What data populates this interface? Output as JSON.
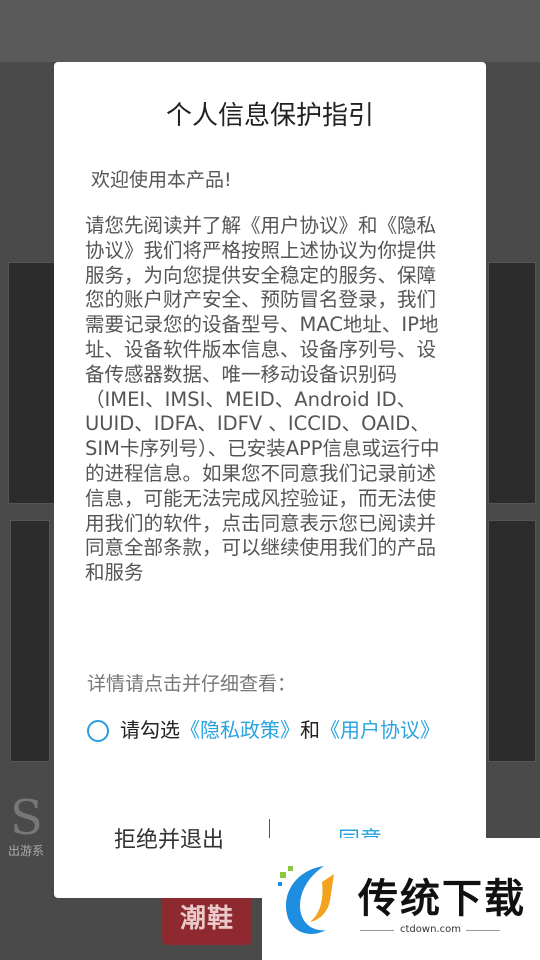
{
  "background": {
    "badge_text": "潮鞋",
    "caption": "出游系"
  },
  "dialog": {
    "title": "个人信息保护指引",
    "welcome": "欢迎使用本产品!",
    "body": "请您先阅读并了解《用户协议》和《隐私协议》我们将严格按照上述协议为你提供服务，为向您提供安全稳定的服务、保障您的账户财产安全、预防冒名登录，我们需要记录您的设备型号、MAC地址、IP地址、设备软件版本信息、设备序列号、设备传感器数据、唯一移动设备识别码（IMEI、IMSI、MEID、Android ID、UUID、IDFA、IDFV 、ICCID、OAID、SIM卡序列号）、已安装APP信息或运行中的进程信息。如果您不同意我们记录前述信息，可能无法完成风控验证，而无法使用我们的软件，点击同意表示您已阅读并同意全部条款，可以继续使用我们的产品和服务",
    "hint": "详情请点击并仔细查看：",
    "consent": {
      "prefix": "请勾选",
      "privacy_link": "《隐私政策》",
      "conjunction": "和",
      "user_link": "《用户协议》",
      "checked": false
    },
    "reject_label": "拒绝并退出",
    "agree_label": "同意"
  },
  "watermark": {
    "name": "传统下载",
    "url": "ctdown.com"
  },
  "colors": {
    "accent": "#2aa4e0",
    "text": "#555555",
    "overlay": "#4a4a4a"
  }
}
